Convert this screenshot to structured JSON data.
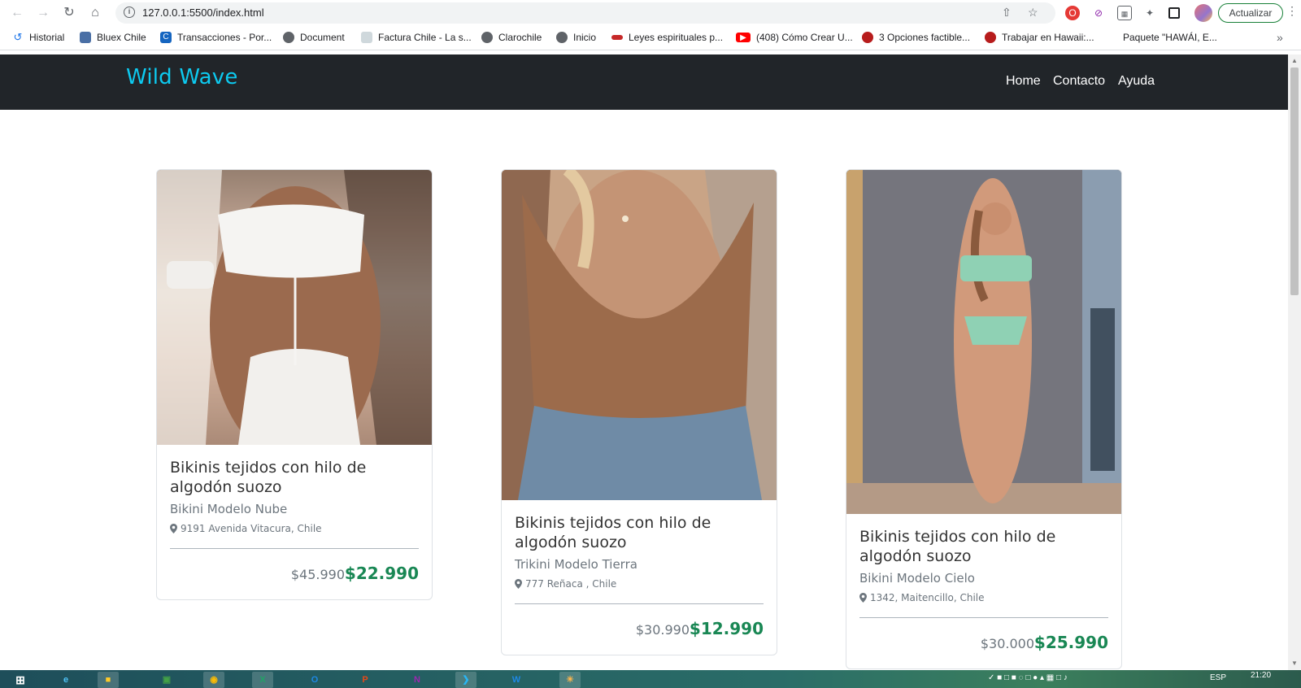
{
  "browser": {
    "url": "127.0.0.1:5500/index.html",
    "update_label": "Actualizar",
    "bookmarks": [
      {
        "label": "Historial",
        "icon": "history-icon",
        "color": "#1a73e8"
      },
      {
        "label": "Bluex Chile",
        "icon": "bluex-icon",
        "color": "#4a6fa5"
      },
      {
        "label": "Transacciones - Por...",
        "icon": "transacciones-icon",
        "color": "#1565c0"
      },
      {
        "label": "Document",
        "icon": "globe-icon",
        "color": "#5f6368"
      },
      {
        "label": "Factura Chile - La s...",
        "icon": "factura-icon",
        "color": "#9aa0a6"
      },
      {
        "label": "Clarochile",
        "icon": "globe-icon",
        "color": "#5f6368"
      },
      {
        "label": "Inicio",
        "icon": "globe-icon",
        "color": "#5f6368"
      },
      {
        "label": "Leyes espirituales p...",
        "icon": "leyes-icon",
        "color": "#c62828"
      },
      {
        "label": "(408) Cómo Crear U...",
        "icon": "youtube-icon",
        "color": "#ff0000"
      },
      {
        "label": "3 Opciones factible...",
        "icon": "opciones-icon",
        "color": "#b71c1c"
      },
      {
        "label": "Trabajar en Hawaii:...",
        "icon": "hawaii-icon",
        "color": "#b71c1c"
      },
      {
        "label": "Paquete \"HAWÁI, E...",
        "icon": "paquete-icon",
        "color": "#ffffff"
      }
    ]
  },
  "site": {
    "brand": "Wild Wave",
    "nav": [
      "Home",
      "Contacto",
      "Ayuda"
    ],
    "colors": {
      "navbar": "#212529",
      "brand": "#0dcaf0",
      "price": "#198754"
    }
  },
  "products": [
    {
      "title": "Bikinis tejidos con hilo de algodón suozo",
      "model": "Bikini Modelo Nube",
      "location": "9191 Avenida Vitacura, Chile",
      "old_price": "$45.990",
      "price": "$22.990"
    },
    {
      "title": "Bikinis tejidos con hilo de algodón suozo",
      "model": "Trikini Modelo Tierra",
      "location": "777 Reñaca , Chile",
      "old_price": "$30.990",
      "price": "$12.990"
    },
    {
      "title": "Bikinis tejidos con hilo de algodón suozo",
      "model": "Bikini Modelo Cielo",
      "location": "1342, Maitencillo, Chile",
      "old_price": "$30.000",
      "price": "$25.990"
    }
  ],
  "taskbar": {
    "lang": "ESP",
    "time": "21:20"
  }
}
